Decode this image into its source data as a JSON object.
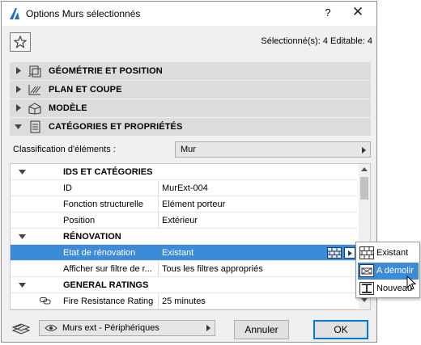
{
  "window": {
    "title": "Options Murs sélectionnés",
    "help_label": "?",
    "close_label": "✕"
  },
  "header": {
    "selected_info": "Sélectionné(s): 4 Editable: 4"
  },
  "sections": [
    {
      "label": "GÉOMÉTRIE ET POSITION",
      "icon": "geometry-icon",
      "expanded": false
    },
    {
      "label": "PLAN ET COUPE",
      "icon": "plan-section-icon",
      "expanded": false
    },
    {
      "label": "MODÈLE",
      "icon": "model-icon",
      "expanded": false
    },
    {
      "label": "CATÉGORIES ET PROPRIÉTÉS",
      "icon": "categories-icon",
      "expanded": true
    }
  ],
  "classification": {
    "label": "Classification d'éléments :",
    "value": "Mur"
  },
  "grid": {
    "rows": [
      {
        "type": "group",
        "label": "IDS ET CATÉGORIES",
        "value": ""
      },
      {
        "type": "item",
        "label": "ID",
        "value": "MurExt-004"
      },
      {
        "type": "item",
        "label": "Fonction structurelle",
        "value": "Elément porteur"
      },
      {
        "type": "item",
        "label": "Position",
        "value": "Extérieur"
      },
      {
        "type": "group",
        "label": "RÉNOVATION",
        "value": ""
      },
      {
        "type": "item",
        "label": "Etat de rénovation",
        "value": "Existant",
        "selected": true
      },
      {
        "type": "item",
        "label": "Afficher sur filtre de r...",
        "value": "Tous les filtres appropriés"
      },
      {
        "type": "group",
        "label": "GENERAL RATINGS",
        "value": ""
      },
      {
        "type": "item",
        "label": "Fire Resistance Rating",
        "value": "25 minutes",
        "icon": "link-icon"
      }
    ]
  },
  "renovation_popup": {
    "items": [
      {
        "label": "Existant",
        "icon": "existing-brick-icon"
      },
      {
        "label": "A démolir",
        "icon": "demolish-icon",
        "active": true
      },
      {
        "label": "Nouveau",
        "icon": "new-element-icon"
      }
    ]
  },
  "footer": {
    "view_label": "Murs ext - Périphériques",
    "cancel_label": "Annuler",
    "ok_label": "OK"
  },
  "colors": {
    "selection": "#3b8bd9",
    "section_bg": "#dcdcdc",
    "dialog_bg": "#f0f0f0",
    "ok_border": "#0078d7"
  }
}
